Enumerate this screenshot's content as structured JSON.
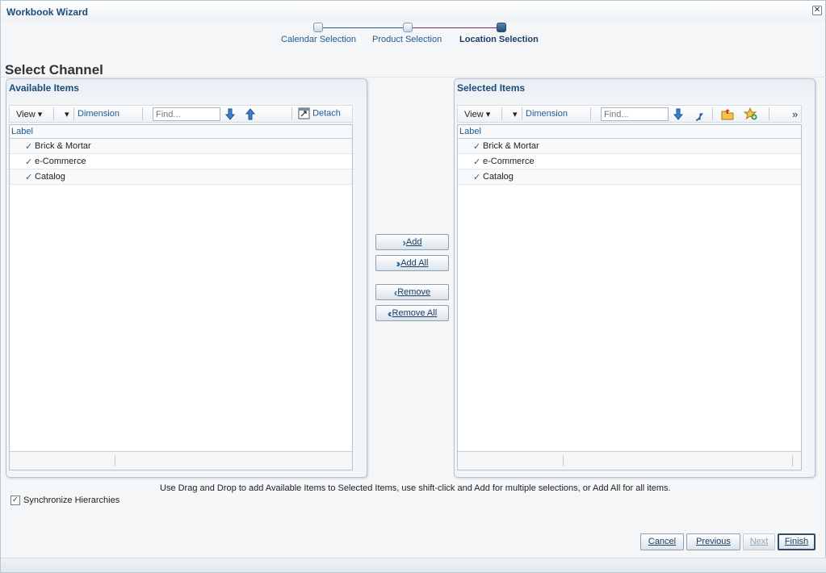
{
  "window": {
    "title": "Workbook Wizard"
  },
  "train": [
    {
      "label": "Calendar Selection"
    },
    {
      "label": "Product Selection"
    },
    {
      "label": "Location Selection"
    }
  ],
  "page_title": "Select Channel",
  "available": {
    "header": "Available Items",
    "view": "View",
    "dimension": "Dimension",
    "find_placeholder": "Find...",
    "detach": "Detach",
    "column": "Label",
    "rows": [
      "Brick & Mortar",
      "e-Commerce",
      "Catalog"
    ]
  },
  "selected": {
    "header": "Selected Items",
    "view": "View",
    "dimension": "Dimension",
    "find_placeholder": "Find...",
    "more": "»",
    "column": "Label",
    "rows": [
      "Brick & Mortar",
      "e-Commerce",
      "Catalog"
    ]
  },
  "shuttle": {
    "add": "Add",
    "add_all": "Add All",
    "remove": "Remove",
    "remove_all": "Remove All"
  },
  "hint": "Use Drag and Drop to add Available Items to Selected Items, use shift-click and Add for multiple selections, or Add All for all items.",
  "sync": {
    "label": "Synchronize Hierarchies",
    "checked": true
  },
  "footer": {
    "cancel": "Cancel",
    "previous": "Previous",
    "next": "Next",
    "finish": "Finish"
  },
  "colors": {
    "accent": "#1c4b78",
    "link": "#1f5a91",
    "train_done_line": "#2a5d8c",
    "train_current_line": "#7a2a6a"
  }
}
